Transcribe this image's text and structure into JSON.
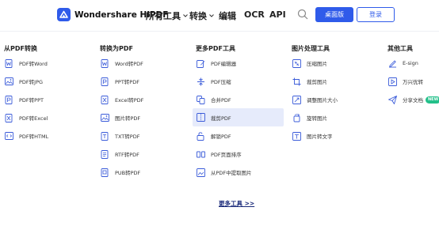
{
  "header": {
    "brand": "Wondershare HiPDF",
    "nav": [
      "所有工具",
      "转换",
      "编辑",
      "OCR",
      "API"
    ],
    "primary_button": "桌面版",
    "login_button": "登录"
  },
  "columns": [
    {
      "title": "从PDF转换",
      "items": [
        {
          "label": "PDF转Word",
          "icon": "word-doc-icon"
        },
        {
          "label": "PDF转JPG",
          "icon": "image-icon"
        },
        {
          "label": "PDF转PPT",
          "icon": "ppt-icon"
        },
        {
          "label": "PDF转Excel",
          "icon": "excel-icon"
        },
        {
          "label": "PDF转HTML",
          "icon": "html-icon"
        }
      ]
    },
    {
      "title": "转换为PDF",
      "items": [
        {
          "label": "Word转PDF",
          "icon": "word-doc-icon"
        },
        {
          "label": "PPT转PDF",
          "icon": "ppt-icon"
        },
        {
          "label": "Excel转PDF",
          "icon": "excel-icon"
        },
        {
          "label": "图片转PDF",
          "icon": "image-icon"
        },
        {
          "label": "TXT转PDF",
          "icon": "txt-icon"
        },
        {
          "label": "RTF转PDF",
          "icon": "rtf-icon"
        },
        {
          "label": "PUB转PDF",
          "icon": "pub-icon"
        }
      ]
    },
    {
      "title": "更多PDF工具",
      "items": [
        {
          "label": "PDF编辑器",
          "icon": "edit-icon"
        },
        {
          "label": "PDF压缩",
          "icon": "compress-icon"
        },
        {
          "label": "合并PDF",
          "icon": "merge-icon"
        },
        {
          "label": "裁剪PDF",
          "icon": "split-icon",
          "active": true
        },
        {
          "label": "解锁PDF",
          "icon": "unlock-icon"
        },
        {
          "label": "PDF页面排序",
          "icon": "pages-icon"
        },
        {
          "label": "从PDF中提取图片",
          "icon": "extract-image-icon"
        }
      ]
    },
    {
      "title": "图片处理工具",
      "items": [
        {
          "label": "压缩图片",
          "icon": "compress-image-icon"
        },
        {
          "label": "裁剪图片",
          "icon": "crop-icon"
        },
        {
          "label": "调整图片大小",
          "icon": "resize-icon"
        },
        {
          "label": "旋转图片",
          "icon": "rotate-icon"
        },
        {
          "label": "图片转文字",
          "icon": "image-to-text-icon"
        }
      ]
    },
    {
      "title": "其他工具",
      "items": [
        {
          "label": "E-sign",
          "icon": "signature-icon"
        },
        {
          "label": "万兴优转",
          "icon": "video-convert-icon"
        },
        {
          "label": "分享文档",
          "icon": "share-icon",
          "badge": "NEW"
        }
      ]
    }
  ],
  "more_link": "更多工具 >>",
  "colors": {
    "accent": "#2f5bea",
    "active_bg": "#e6ebfb",
    "badge": "#23c08a"
  }
}
